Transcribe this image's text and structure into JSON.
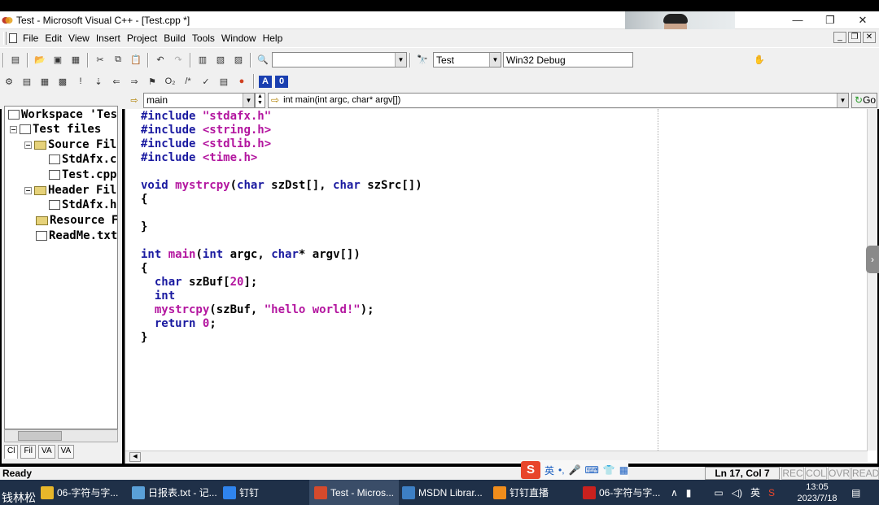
{
  "window": {
    "title": "Test - Microsoft Visual C++ - [Test.cpp *]",
    "controls": [
      "—",
      "❐",
      "✕"
    ]
  },
  "menu": {
    "items": [
      "File",
      "Edit",
      "View",
      "Insert",
      "Project",
      "Build",
      "Tools",
      "Window",
      "Help"
    ],
    "mdi_buttons": [
      "_",
      "❐",
      "✕"
    ]
  },
  "toolbar": {
    "find_value": "",
    "project_combo": "Test",
    "config_combo": "Win32 Debug",
    "badge_a": "A",
    "badge_0": "0"
  },
  "navbar": {
    "scope_combo": "main",
    "function_combo": "int main(int argc, char* argv[])",
    "go_label": "Go"
  },
  "workspace": {
    "tree": [
      {
        "label": "Workspace 'Tes",
        "kind": "workspace"
      },
      {
        "label": "Test files",
        "kind": "project"
      },
      {
        "label": "Source Fil",
        "kind": "folder"
      },
      {
        "label": "StdAfx.c",
        "kind": "file"
      },
      {
        "label": "Test.cpp",
        "kind": "file"
      },
      {
        "label": "Header Fil",
        "kind": "folder"
      },
      {
        "label": "StdAfx.h",
        "kind": "file"
      },
      {
        "label": "Resource F",
        "kind": "folder"
      },
      {
        "label": "ReadMe.txt",
        "kind": "file"
      }
    ],
    "tabs": [
      "Cl",
      "Fil",
      "VA",
      "VA"
    ]
  },
  "code": {
    "lines": [
      "#include \"stdafx.h\"",
      "#include <string.h>",
      "#include <stdlib.h>",
      "#include <time.h>",
      "",
      "void mystrcpy(char szDst[], char szSrc[])",
      "{",
      "",
      "}",
      "",
      "int main(int argc, char* argv[])",
      "{",
      "  char szBuf[20];",
      "  int",
      "  mystrcpy(szBuf, \"hello world!\");",
      "  return 0;",
      "}"
    ]
  },
  "status": {
    "ready": "Ready",
    "position": "Ln 17, Col 7",
    "indicators": [
      "REC",
      "COL",
      "OVR",
      "READ"
    ]
  },
  "ime": {
    "logo": "S",
    "mode": "英"
  },
  "taskbar": {
    "start_caption": "钱林松",
    "tasks": [
      {
        "label": "06-字符与字...",
        "icon_color": "#e7b62a"
      },
      {
        "label": "日报表.txt - 记...",
        "icon_color": "#5aa0d8"
      },
      {
        "label": "钉钉",
        "icon_color": "#2f84ee"
      },
      {
        "label": "Test - Micros...",
        "icon_color": "#d54a2c"
      },
      {
        "label": "MSDN Librar...",
        "icon_color": "#3d7fc4"
      },
      {
        "label": "钉钉直播",
        "icon_color": "#f08d1c"
      },
      {
        "label": "06-字符与字...",
        "icon_color": "#c9211e"
      }
    ],
    "tray_lang": "英",
    "time": "13:05",
    "date": "2023/7/18"
  },
  "colors": {
    "keyword": "#1a1aa0",
    "string": "#b3159f",
    "taskbar": "#1f3048"
  }
}
